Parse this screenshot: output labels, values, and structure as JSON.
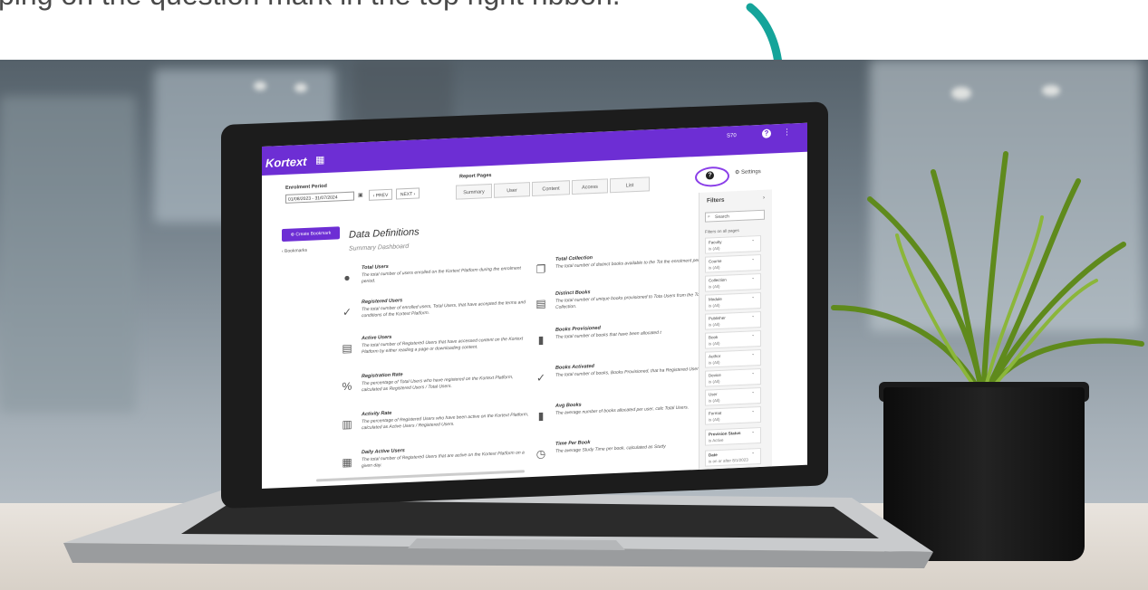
{
  "caption": {
    "text": "ping on the question mark in the top right ribbon."
  },
  "app": {
    "logo": "Kortext",
    "logo_icon": "grid-icon",
    "user_id": "S70",
    "top_help": "?",
    "top_menu": "⋮"
  },
  "header": {
    "enrollment_label": "Enrolment Period",
    "enrollment_value": "01/08/2023 - 31/07/2024",
    "prev": "‹ PREV",
    "next": "NEXT ›",
    "report_pages_label": "Report Pages",
    "tabs": [
      "Summary",
      "User",
      "Content",
      "Access",
      "List"
    ],
    "help": "?",
    "settings": "⚙ Settings"
  },
  "sidebar": {
    "create_bookmark": "⊕ Create Bookmark",
    "bookmarks": "‹ Bookmarks"
  },
  "main": {
    "title": "Data Definitions",
    "subtitle": "Summary Dashboard",
    "definitions_left": [
      {
        "title": "Total Users",
        "text": "The total number of users enrolled on the Kortext Platform during the enrolment period."
      },
      {
        "title": "Registered Users",
        "text": "The total number of enrolled users, Total Users, that have accepted the terms and conditions of the Kortext Platform."
      },
      {
        "title": "Active Users",
        "text": "The total number of Registered Users that have accessed content on the Kortext Platform by either reading a page or downloading content."
      },
      {
        "title": "Registration Rate",
        "text": "The percentage of Total Users who have registered on the Kortext Platform, calculated as Registered Users / Total Users."
      },
      {
        "title": "Activity Rate",
        "text": "The percentage of Registered Users who have been active on the Kortext Platform, calculated as Active Users / Registered Users."
      },
      {
        "title": "Daily Active Users",
        "text": "The total number of Registered Users that are active on the Kortext Platform on a given day."
      }
    ],
    "definitions_right": [
      {
        "title": "Total Collection",
        "text": "The total number of distinct books available to the Tot the enrolment period."
      },
      {
        "title": "Distinct Books",
        "text": "The total number of unique books provisioned to Tota Users from the Total Collection."
      },
      {
        "title": "Books Provisioned",
        "text": "The total number of books that have been allocated t"
      },
      {
        "title": "Books Activated",
        "text": "The total number of books, Books Provisioned, that ha Registered Users."
      },
      {
        "title": "Avg Books",
        "text": "The average number of books allocated per user, calc Total Users."
      },
      {
        "title": "Time Per Book",
        "text": "The average Study Time per book, calculated as Study"
      }
    ]
  },
  "filters": {
    "title": "Filters",
    "chevron": "›",
    "search_placeholder": "Search",
    "on_all_pages": "Filters on all pages",
    "items": [
      {
        "name": "Faculty",
        "value": "is (All)"
      },
      {
        "name": "Course",
        "value": "is (All)"
      },
      {
        "name": "Collection",
        "value": "is (All)"
      },
      {
        "name": "Module",
        "value": "is (All)"
      },
      {
        "name": "Publisher",
        "value": "is (All)"
      },
      {
        "name": "Book",
        "value": "is (All)"
      },
      {
        "name": "Author",
        "value": "is (All)"
      },
      {
        "name": "Device",
        "value": "is (All)"
      },
      {
        "name": "User",
        "value": "is (All)"
      },
      {
        "name": "Format",
        "value": "is (All)"
      },
      {
        "name": "Provision Status",
        "value": "is Active"
      },
      {
        "name": "Date",
        "value": "is on or after 8/1/2023"
      }
    ]
  }
}
